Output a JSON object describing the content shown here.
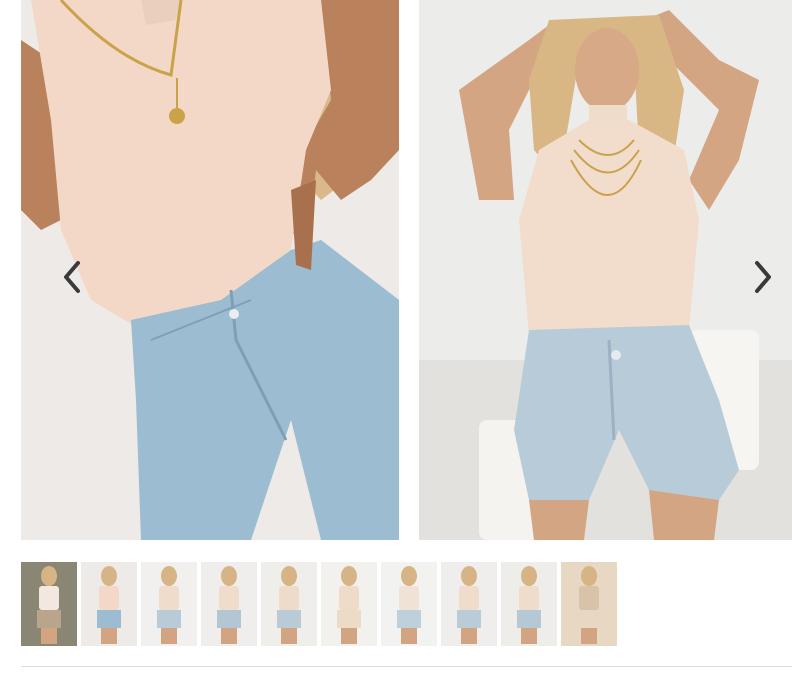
{
  "gallery": {
    "slides": [
      {
        "name": "product-photo-closeup",
        "background": "#eeeae7",
        "top_color": "#f4d8c7",
        "denim_color": "#9cbcd1",
        "skin_color": "#b9815c"
      },
      {
        "name": "product-photo-model",
        "background": "#ececeb",
        "top_color": "#f2ddcc",
        "denim_color": "#b7cbd8",
        "skin_color": "#d3a583"
      }
    ],
    "prev_icon": "chevron-left-icon",
    "next_icon": "chevron-right-icon"
  },
  "thumbnails": [
    {
      "background": "#8a8674",
      "top": "#f2e8e0",
      "bottom": "#b9a48c"
    },
    {
      "background": "#eeeae7",
      "top": "#f4d8c7",
      "bottom": "#9cbcd1"
    },
    {
      "background": "#f1f0ee",
      "top": "#efdccb",
      "bottom": "#b9cbd8"
    },
    {
      "background": "#f0eeec",
      "top": "#f0dccb",
      "bottom": "#b3c6d4"
    },
    {
      "background": "#efeeea",
      "top": "#efdbc9",
      "bottom": "#b8cbd7"
    },
    {
      "background": "#f3f1ee",
      "top": "#efdcc8",
      "bottom": "#ecdcc6"
    },
    {
      "background": "#f2f2f0",
      "top": "#f0e3d6",
      "bottom": "#bdd0dc"
    },
    {
      "background": "#efeeec",
      "top": "#efdccb",
      "bottom": "#b9ccd8"
    },
    {
      "background": "#efede9",
      "top": "#efdccb",
      "bottom": "#b5c8d5"
    },
    {
      "background": "#e7d7c3",
      "top": "#d9c3a8",
      "bottom": "#e7d7c3"
    }
  ],
  "colors": {
    "divider": "#dcdcdc",
    "arrow": "#3a3a3a"
  }
}
